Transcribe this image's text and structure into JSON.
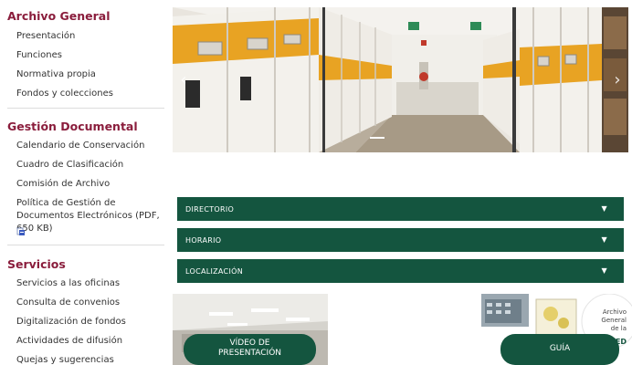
{
  "sidebar": {
    "archivo_general": {
      "title": "Archivo General",
      "items": [
        "Presentación",
        "Funciones",
        "Normativa propia",
        "Fondos y colecciones"
      ]
    },
    "gestion_documental": {
      "title": "Gestión Documental",
      "items": [
        "Calendario de Conservación",
        "Cuadro de Clasificación",
        "Comisión de Archivo",
        "Política de Gestión de Documentos Electrónicos (PDF, 650 KB)"
      ]
    },
    "servicios": {
      "title": "Servicios",
      "items": [
        "Servicios a las oficinas",
        "Consulta de convenios",
        "Digitalización de fondos",
        "Actividades de difusión",
        "Quejas y sugerencias"
      ]
    }
  },
  "accordions": [
    {
      "label": "DIRECTORIO",
      "caret": "▼"
    },
    {
      "label": "HORARIO",
      "caret": "▼"
    },
    {
      "label": "LOCALIZACIÓN",
      "caret": "▼"
    }
  ],
  "carousel": {
    "prev": "‹",
    "next": "›"
  },
  "cards": {
    "video": {
      "label_line1": "VÍDEO DE",
      "label_line2": "PRESENTACIÓN"
    },
    "guide": {
      "label": "GUÍA",
      "logo_line1": "Archivo",
      "logo_line2": "General",
      "logo_line3": "de la",
      "logo_line4": "ED"
    }
  },
  "colors": {
    "brand_maroon": "#8a1d3c",
    "brand_green": "#14553f",
    "cabinet_orange": "#e8a323"
  }
}
